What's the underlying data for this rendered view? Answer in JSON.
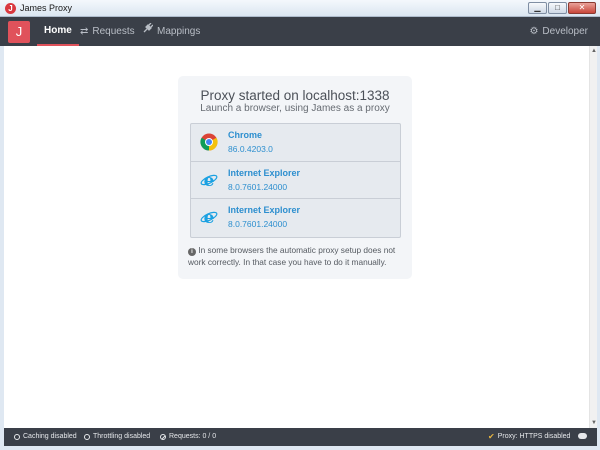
{
  "window": {
    "title": "James Proxy",
    "app_icon_letter": "J"
  },
  "navbar": {
    "logo": "J",
    "items": [
      {
        "label": "Home",
        "icon": "home",
        "active": true
      },
      {
        "label": "Requests",
        "icon": "exchange-arrows-icon",
        "active": false
      },
      {
        "label": "Mappings",
        "icon": "plug-icon",
        "active": false
      }
    ],
    "developer": {
      "label": "Developer",
      "icon": "gear-icon"
    }
  },
  "main": {
    "title": "Proxy started on localhost:1338",
    "subtitle": "Launch a browser, using James as a proxy",
    "browsers": [
      {
        "name": "Chrome",
        "version": "86.0.4203.0",
        "icon": "chrome-icon"
      },
      {
        "name": "Internet Explorer",
        "version": "8.0.7601.24000",
        "icon": "internet-explorer-icon"
      },
      {
        "name": "Internet Explorer",
        "version": "8.0.7601.24000",
        "icon": "internet-explorer-icon"
      }
    ],
    "note": "In some browsers the automatic proxy setup does not work correctly. In that case you have to do it manually."
  },
  "statusbar": {
    "caching": "Caching disabled",
    "throttling": "Throttling disabled",
    "requests": "Requests: 0 / 0",
    "proxy": "Proxy: HTTPS disabled"
  },
  "colors": {
    "accent": "#e0525b",
    "nav_bg": "#3a3f48",
    "link": "#2d8fcf"
  }
}
